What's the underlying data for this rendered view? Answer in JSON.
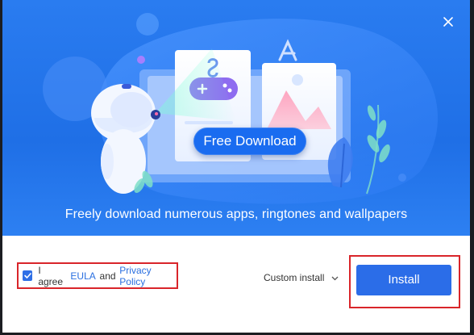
{
  "hero": {
    "free_download_label": "Free Download",
    "tagline": "Freely download numerous apps, ringtones and wallpapers",
    "colors": {
      "background": "#1f6fe6",
      "button": "#1a6cf0"
    }
  },
  "footer": {
    "agree_prefix": "I agree",
    "eula_link": "EULA",
    "and_text": "and",
    "privacy_link": "Privacy Policy",
    "agree_checked": true,
    "custom_install_label": "Custom install",
    "install_label": "Install",
    "colors": {
      "install_button": "#2b6de8",
      "highlight": "#d9252a",
      "link": "#2a6fe0"
    }
  },
  "icons": [
    "close-icon",
    "robot-mascot",
    "game-controller-icon",
    "app-store-icon",
    "image-icon",
    "checkmark-icon",
    "chevron-down-icon"
  ]
}
